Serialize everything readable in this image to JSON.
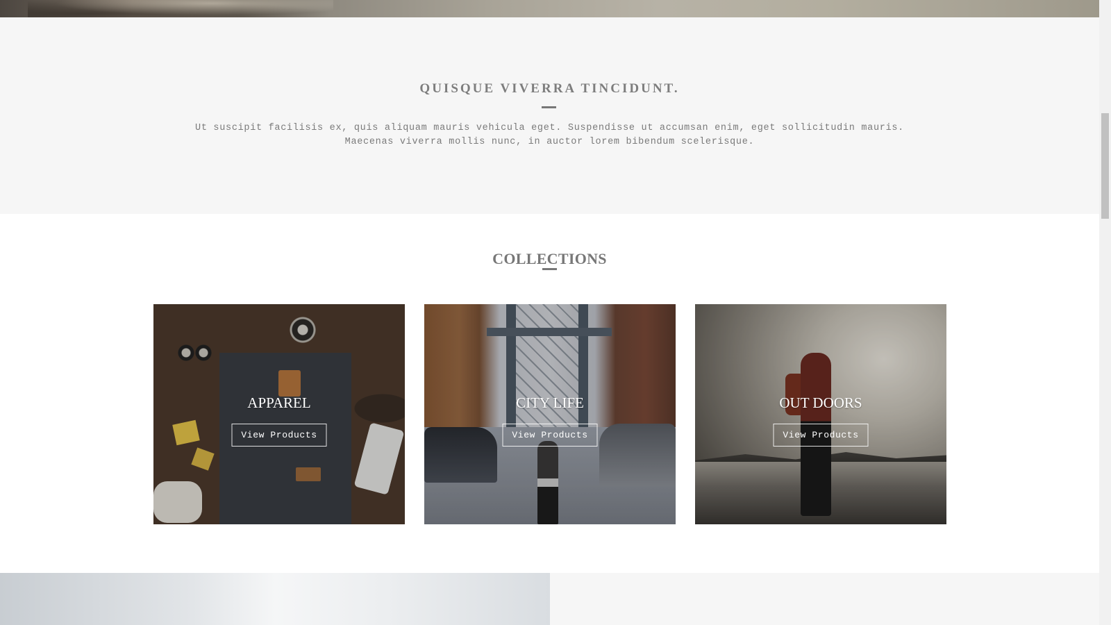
{
  "intro": {
    "title": "QUISQUE VIVERRA TINCIDUNT.",
    "text_line1": "Ut suscipit facilisis ex, quis aliquam mauris vehicula eget. Suspendisse ut accumsan enim, eget sollicitudin mauris.",
    "text_line2": "Maecenas viverra mollis nunc, in auctor lorem bibendum scelerisque."
  },
  "collections": {
    "title": "COLLECTIONS",
    "cards": [
      {
        "title": "APPAREL",
        "button": "View Products"
      },
      {
        "title": "CITY LIFE",
        "button": "View Products"
      },
      {
        "title": "OUT DOORS",
        "button": "View Products"
      }
    ]
  },
  "colors": {
    "section_bg": "#f6f6f6",
    "text_gray": "#7d7d7d"
  }
}
